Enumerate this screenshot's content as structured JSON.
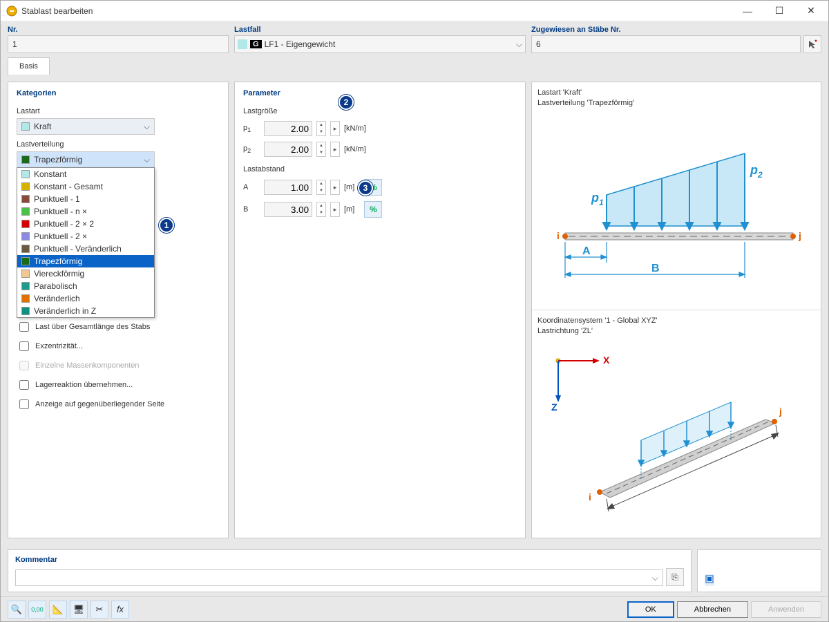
{
  "window": {
    "title": "Stablast bearbeiten"
  },
  "header": {
    "nr": {
      "label": "Nr.",
      "value": "1"
    },
    "lastfall": {
      "label": "Lastfall",
      "badge": "G",
      "value": "LF1 - Eigengewicht"
    },
    "zugewiesen": {
      "label": "Zugewiesen an Stäbe Nr.",
      "value": "6"
    }
  },
  "tabs": {
    "basis": "Basis"
  },
  "categories": {
    "title": "Kategorien",
    "lastart": {
      "label": "Lastart",
      "value": "Kraft"
    },
    "lastverteilung": {
      "label": "Lastverteilung",
      "value": "Trapezförmig",
      "options": [
        {
          "label": "Konstant",
          "color": "#b2e8e8"
        },
        {
          "label": "Konstant - Gesamt",
          "color": "#d4b400"
        },
        {
          "label": "Punktuell - 1",
          "color": "#8a4a3a"
        },
        {
          "label": "Punktuell - n ×",
          "color": "#4ac24a"
        },
        {
          "label": "Punktuell - 2 × 2",
          "color": "#d40000"
        },
        {
          "label": "Punktuell - 2 ×",
          "color": "#8a8ae0"
        },
        {
          "label": "Punktuell - Veränderlich",
          "color": "#6a5a40"
        },
        {
          "label": "Trapezförmig",
          "color": "#1a6a1a"
        },
        {
          "label": "Viereckförmig",
          "color": "#f0c890"
        },
        {
          "label": "Parabolisch",
          "color": "#209a8a"
        },
        {
          "label": "Veränderlich",
          "color": "#e07000"
        },
        {
          "label": "Veränderlich in Z",
          "color": "#109080"
        }
      ],
      "selected_index": 7
    }
  },
  "options": {
    "over_length": "Last über Gesamtlänge des Stabs",
    "eccentricity": "Exzentrizität...",
    "mass_components": "Einzelne Massenkomponenten",
    "support_reaction": "Lagerreaktion übernehmen...",
    "opposite_side": "Anzeige auf gegenüberliegender Seite"
  },
  "parameter": {
    "title": "Parameter",
    "lastgroesse": "Lastgröße",
    "p1": {
      "label": "p",
      "sub": "1",
      "value": "2.00",
      "unit": "[kN/m]"
    },
    "p2": {
      "label": "p",
      "sub": "2",
      "value": "2.00",
      "unit": "[kN/m]"
    },
    "lastabstand": "Lastabstand",
    "a": {
      "label": "A",
      "value": "1.00",
      "unit": "[m]"
    },
    "b": {
      "label": "B",
      "value": "3.00",
      "unit": "[m]"
    },
    "pct": "%"
  },
  "diagram": {
    "top_line1": "Lastart 'Kraft'",
    "top_line2": "Lastverteilung 'Trapezförmig'",
    "bot_line1": "Koordinatensystem '1 - Global XYZ'",
    "bot_line2": "Lastrichtung 'ZL'",
    "p1_label": "p",
    "p1_sub": "1",
    "p2_label": "p",
    "p2_sub": "2",
    "i": "i",
    "j": "j",
    "A": "A",
    "B": "B",
    "X": "X",
    "Z": "Z"
  },
  "kommentar": {
    "title": "Kommentar"
  },
  "footer": {
    "ok": "OK",
    "cancel": "Abbrechen",
    "apply": "Anwenden"
  },
  "callouts": {
    "c1": "1",
    "c2": "2",
    "c3": "3"
  }
}
